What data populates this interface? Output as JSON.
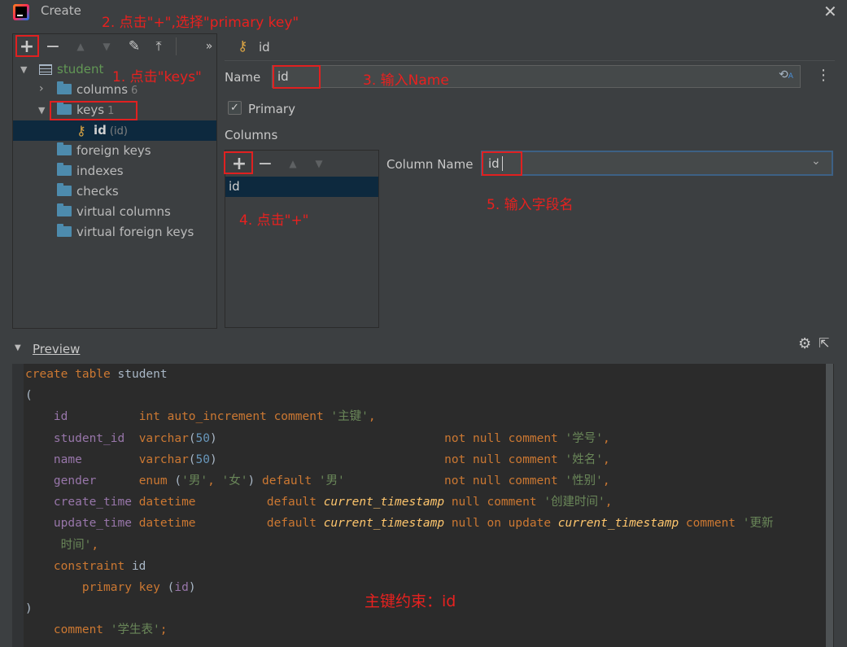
{
  "window": {
    "title": "Create"
  },
  "annotations": {
    "step1": "1. 点击\"keys\"",
    "step2": "2. 点击\"+\",选择\"primary key\"",
    "step3": "3. 输入Name",
    "step4": "4. 点击\"+\"",
    "step5": "5. 输入字段名",
    "pk_note": "主键约束：id"
  },
  "tree": {
    "root": "student",
    "items": [
      {
        "label": "columns",
        "count": "6"
      },
      {
        "label": "keys",
        "count": "1"
      },
      {
        "label": "id",
        "sub": "(id)"
      },
      {
        "label": "foreign keys"
      },
      {
        "label": "indexes"
      },
      {
        "label": "checks"
      },
      {
        "label": "virtual columns"
      },
      {
        "label": "virtual foreign keys"
      }
    ]
  },
  "detail": {
    "header": "id",
    "name_label": "Name",
    "name_value": "id",
    "primary_label": "Primary",
    "primary_checked": true,
    "columns_label": "Columns",
    "columns_list": [
      "id"
    ],
    "column_name_label": "Column Name",
    "column_name_value": "id"
  },
  "preview": {
    "title": "Preview",
    "lines": [
      [
        [
          "kw",
          "create table "
        ],
        [
          "plain",
          "student"
        ]
      ],
      [
        [
          "plain",
          "("
        ]
      ],
      [
        [
          "plain",
          "    "
        ],
        [
          "id",
          "id"
        ],
        [
          "plain",
          "          "
        ],
        [
          "kw",
          "int auto_increment comment "
        ],
        [
          "str",
          "'主键'"
        ],
        [
          "kw",
          ","
        ]
      ],
      [
        [
          "plain",
          "    "
        ],
        [
          "id",
          "student_id"
        ],
        [
          "plain",
          "  "
        ],
        [
          "kw",
          "varchar"
        ],
        [
          "plain",
          "("
        ],
        [
          "num",
          "50"
        ],
        [
          "plain",
          ")"
        ],
        [
          "plain",
          "                                "
        ],
        [
          "kw",
          "not null comment "
        ],
        [
          "str",
          "'学号'"
        ],
        [
          "kw",
          ","
        ]
      ],
      [
        [
          "plain",
          "    "
        ],
        [
          "id",
          "name"
        ],
        [
          "plain",
          "        "
        ],
        [
          "kw",
          "varchar"
        ],
        [
          "plain",
          "("
        ],
        [
          "num",
          "50"
        ],
        [
          "plain",
          ")"
        ],
        [
          "plain",
          "                                "
        ],
        [
          "kw",
          "not null comment "
        ],
        [
          "str",
          "'姓名'"
        ],
        [
          "kw",
          ","
        ]
      ],
      [
        [
          "plain",
          "    "
        ],
        [
          "id",
          "gender"
        ],
        [
          "plain",
          "      "
        ],
        [
          "kw",
          "enum "
        ],
        [
          "plain",
          "("
        ],
        [
          "str",
          "'男'"
        ],
        [
          "kw",
          ", "
        ],
        [
          "str",
          "'女'"
        ],
        [
          "plain",
          ") "
        ],
        [
          "kw",
          "default "
        ],
        [
          "str",
          "'男'"
        ],
        [
          "plain",
          "              "
        ],
        [
          "kw",
          "not null comment "
        ],
        [
          "str",
          "'性别'"
        ],
        [
          "kw",
          ","
        ]
      ],
      [
        [
          "plain",
          "    "
        ],
        [
          "id",
          "create_time"
        ],
        [
          "plain",
          " "
        ],
        [
          "kw",
          "datetime"
        ],
        [
          "plain",
          "          "
        ],
        [
          "kw",
          "default "
        ],
        [
          "fn",
          "current_timestamp"
        ],
        [
          "plain",
          " "
        ],
        [
          "kw",
          "null comment "
        ],
        [
          "str",
          "'创建时间'"
        ],
        [
          "kw",
          ","
        ]
      ],
      [
        [
          "plain",
          "    "
        ],
        [
          "id",
          "update_time"
        ],
        [
          "plain",
          " "
        ],
        [
          "kw",
          "datetime"
        ],
        [
          "plain",
          "          "
        ],
        [
          "kw",
          "default "
        ],
        [
          "fn",
          "current_timestamp"
        ],
        [
          "plain",
          " "
        ],
        [
          "kw",
          "null on update "
        ],
        [
          "fn",
          "current_timestamp"
        ],
        [
          "plain",
          " "
        ],
        [
          "kw",
          "comment "
        ],
        [
          "str",
          "'更新"
        ]
      ],
      [
        [
          "plain",
          "     "
        ],
        [
          "str",
          "时间'"
        ],
        [
          "kw",
          ","
        ]
      ],
      [
        [
          "plain",
          "    "
        ],
        [
          "kw",
          "constraint "
        ],
        [
          "plain",
          "id"
        ]
      ],
      [
        [
          "plain",
          "        "
        ],
        [
          "kw",
          "primary key "
        ],
        [
          "plain",
          "("
        ],
        [
          "id",
          "id"
        ],
        [
          "plain",
          ")"
        ]
      ],
      [
        [
          "plain",
          ")"
        ]
      ],
      [
        [
          "plain",
          "    "
        ],
        [
          "kw",
          "comment "
        ],
        [
          "str",
          "'学生表'"
        ],
        [
          "kw",
          ";"
        ]
      ]
    ]
  }
}
